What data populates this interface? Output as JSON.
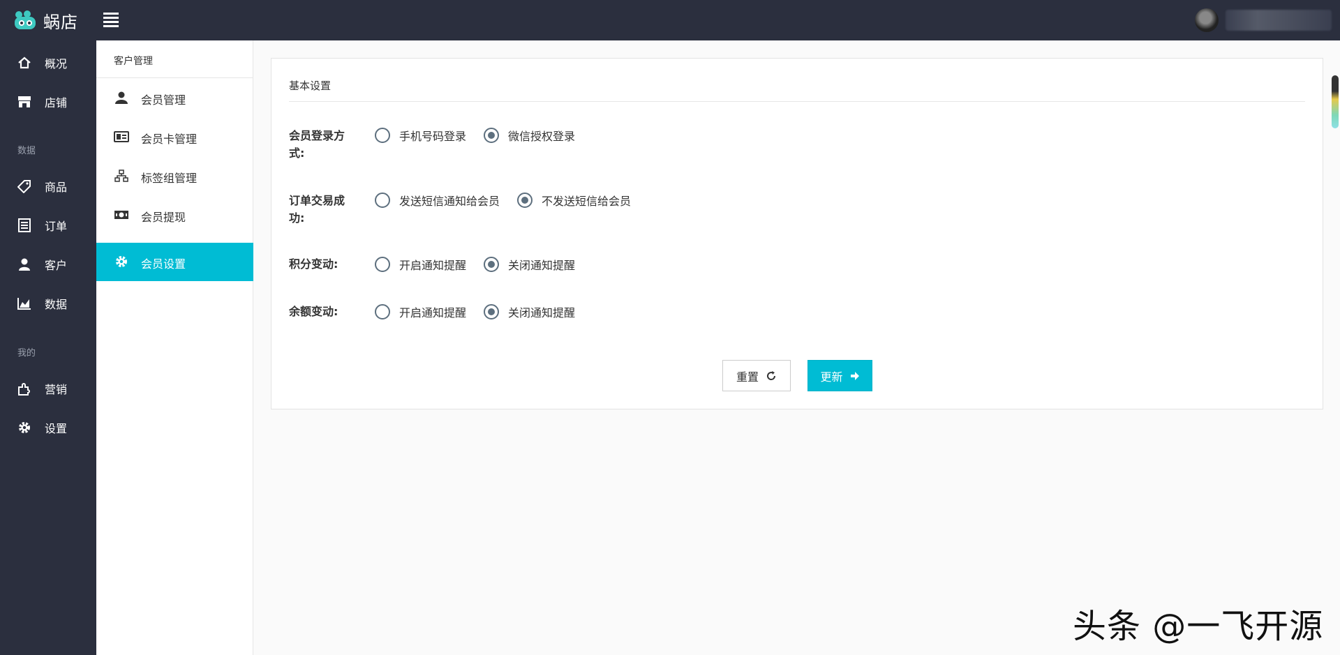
{
  "brand": {
    "name": "蜗店"
  },
  "header": {
    "user_name": ""
  },
  "left_nav": {
    "items": [
      {
        "label": "概况",
        "icon": "home-icon"
      },
      {
        "label": "店铺",
        "icon": "store-icon"
      },
      {
        "label": "商品",
        "icon": "tag-icon"
      },
      {
        "label": "订单",
        "icon": "list-icon"
      },
      {
        "label": "客户",
        "icon": "user-icon"
      },
      {
        "label": "数据",
        "icon": "chart-icon"
      },
      {
        "label": "营销",
        "icon": "puzzle-icon"
      },
      {
        "label": "设置",
        "icon": "gear-icon"
      }
    ],
    "groups": [
      "数据",
      "我的"
    ]
  },
  "sub_nav": {
    "title": "客户管理",
    "items": [
      {
        "label": "会员管理",
        "icon": "member-icon"
      },
      {
        "label": "会员卡管理",
        "icon": "card-icon"
      },
      {
        "label": "标签组管理",
        "icon": "sitemap-icon"
      },
      {
        "label": "会员提现",
        "icon": "cash-icon"
      },
      {
        "label": "会员设置",
        "icon": "gear-icon",
        "active": true
      }
    ]
  },
  "main": {
    "section_title": "基本设置",
    "fields": [
      {
        "label": "会员登录方式:",
        "options": [
          "手机号码登录",
          "微信授权登录"
        ],
        "selected": 1
      },
      {
        "label": "订单交易成功:",
        "options": [
          "发送短信通知给会员",
          "不发送短信给会员"
        ],
        "selected": 1
      },
      {
        "label": "积分变动:",
        "options": [
          "开启通知提醒",
          "关闭通知提醒"
        ],
        "selected": 1
      },
      {
        "label": "余额变动:",
        "options": [
          "开启通知提醒",
          "关闭通知提醒"
        ],
        "selected": 1
      }
    ],
    "reset_label": "重置",
    "update_label": "更新"
  },
  "watermark": "头条 @一飞开源",
  "colors": {
    "sidebar_bg": "#2b2f3e",
    "accent": "#00bcd4",
    "radio": "#5d6f7e"
  }
}
